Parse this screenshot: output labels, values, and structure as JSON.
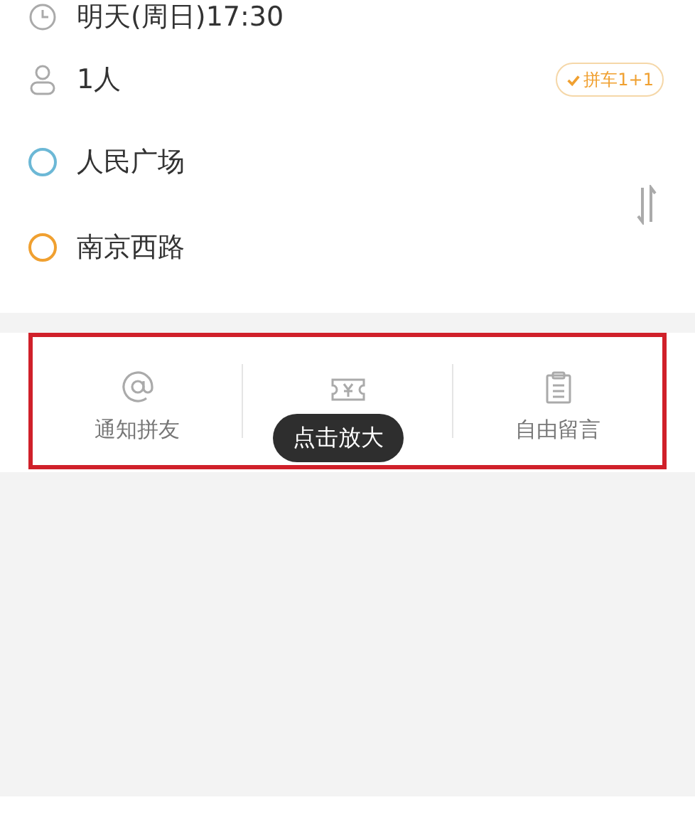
{
  "trip": {
    "time": "明天(周日)17:30",
    "passengers": "1人",
    "carpool_badge": {
      "label": "拼车1+1",
      "checked": true
    },
    "start": {
      "name": "人民广场",
      "color": "#6cb8d6"
    },
    "end": {
      "name": "南京西路",
      "color": "#f0a030"
    }
  },
  "actions": [
    {
      "kind": "at",
      "label": "通知拼友"
    },
    {
      "kind": "ticket"
    },
    {
      "kind": "note",
      "label": "自由留言"
    }
  ],
  "tooltip": "点击放大"
}
